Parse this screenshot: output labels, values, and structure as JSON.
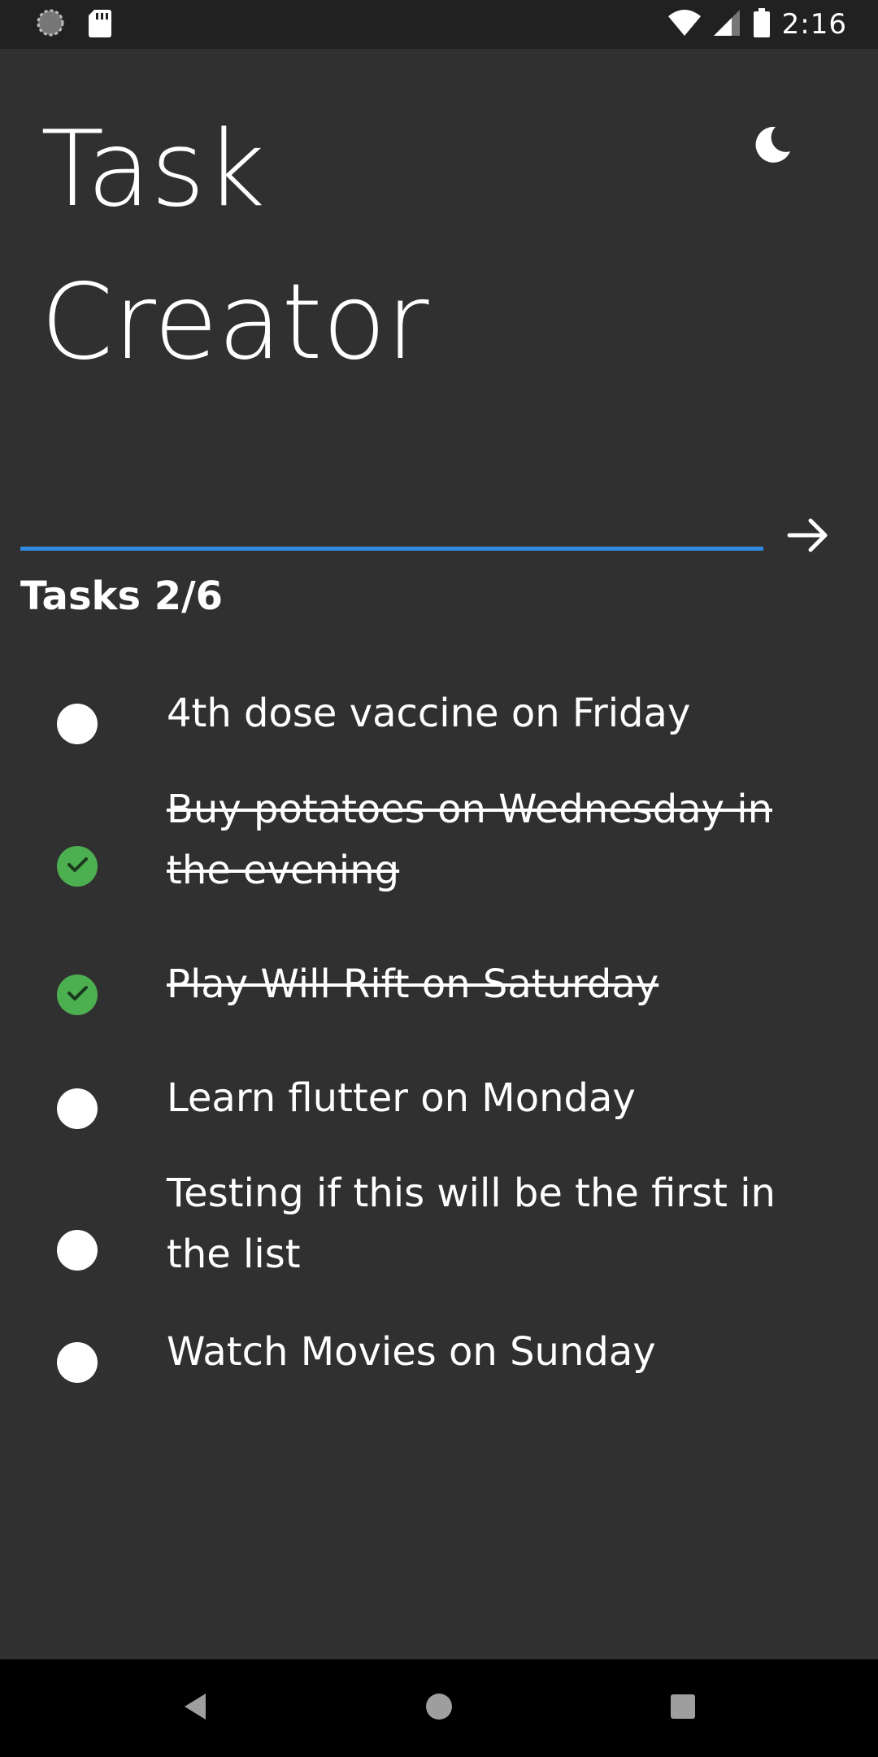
{
  "status_bar": {
    "time": "2:16",
    "icons": [
      "sync-icon",
      "sd-card-icon",
      "wifi-icon",
      "signal-icon",
      "battery-icon"
    ]
  },
  "header": {
    "title_line1": "Task",
    "title_line2": "Creator",
    "theme_icon": "moon-icon"
  },
  "input": {
    "value": "",
    "placeholder": "",
    "submit_icon": "arrow-right-icon"
  },
  "tasks": {
    "header": "Tasks 2/6",
    "completed": 2,
    "total": 6,
    "items": [
      {
        "label": "4th dose vaccine on Friday",
        "done": false
      },
      {
        "label": "Buy potatoes on Wednesday in the evening",
        "done": true
      },
      {
        "label": "Play Will Rift on Saturday",
        "done": true
      },
      {
        "label": "Learn flutter on Monday",
        "done": false
      },
      {
        "label": "Testing if this will be the first in the list",
        "done": false
      },
      {
        "label": "Watch Movies on Sunday",
        "done": false
      }
    ]
  },
  "colors": {
    "background": "#303030",
    "status_bar": "#212121",
    "accent": "#2f8be0",
    "done": "#4caf50",
    "nav_bar": "#000000"
  },
  "nav": {
    "icons": [
      "back-icon",
      "home-icon",
      "recents-icon"
    ]
  }
}
